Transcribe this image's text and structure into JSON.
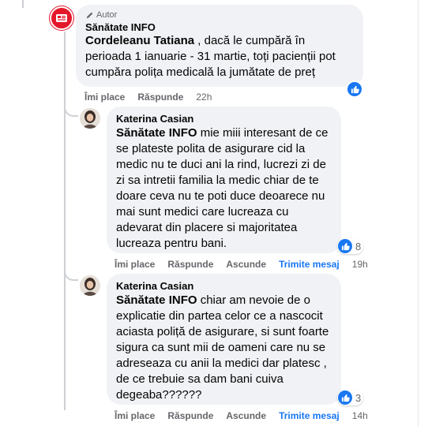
{
  "comments": [
    {
      "author_badge": "Autor",
      "author": "Sănătate INFO",
      "tag": "Cordeleanu Tatiana",
      "text": " , dacă le cumpără în perioada 1 ianuarie - 31 martie, toți pacienții pot cumpăra polița medicală la jumătate de preț",
      "actions": [
        "Îmi place",
        "Răspunde"
      ],
      "time": "22h",
      "reactions": ""
    },
    {
      "author": "Katerina Casian",
      "tag": "Sănătate INFO",
      "text": " mie miii interesant de ce se plateste polita de asigurare cid la medic nu te duci ani la rind, lucrezi zi de zi sa intretii familia la medic chiar de te doare ceva nu te poti duce deoarece nu mai sunt medici care lucreaza cu adevarat din placere si majoritatea lucreaza pentru bani.",
      "actions": [
        "Îmi place",
        "Răspunde",
        "Ascunde",
        "Trimite mesaj"
      ],
      "time": "19h",
      "reactions": "8"
    },
    {
      "author": "Katerina Casian",
      "tag": "Sănătate INFO",
      "text": " chiar am nevoie de o explicatie din partea celor ce a nascocit aciasta poliță de asigurare, si sunt foarte sigura ca sunt mii de oameni care nu se adreseaza cu anii la medici dar platesc , de ce trebuie sa dam bani cuiva degeaba??????",
      "actions": [
        "Îmi place",
        "Răspunde",
        "Ascunde",
        "Trimite mesaj"
      ],
      "time": "14h",
      "reactions": "3"
    }
  ],
  "colors": {
    "accent": "#1877f2",
    "page_avatar": "#e4172b",
    "bubble": "#f0f2f5"
  },
  "icons": {
    "author": "pencil-icon",
    "like": "thumbs-up-icon",
    "page_logo": "newspaper-icon"
  }
}
